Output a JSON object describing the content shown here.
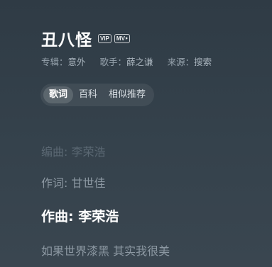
{
  "song": {
    "title": "丑八怪",
    "badges": {
      "vip": "VIP",
      "mv": "MV"
    }
  },
  "meta": {
    "album_label": "专辑：",
    "album_value": "意外",
    "singer_label": "歌手：",
    "singer_value": "薛之谦",
    "source_label": "来源：",
    "source_value": "搜索"
  },
  "tabs": [
    {
      "label": "歌词",
      "active": true
    },
    {
      "label": "百科",
      "active": false
    },
    {
      "label": "相似推荐",
      "active": false
    }
  ],
  "lyrics": [
    "编曲: 李荣浩",
    "作词: 甘世佳",
    "作曲: 李荣浩",
    "如果世界漆黑 其实我很美"
  ]
}
